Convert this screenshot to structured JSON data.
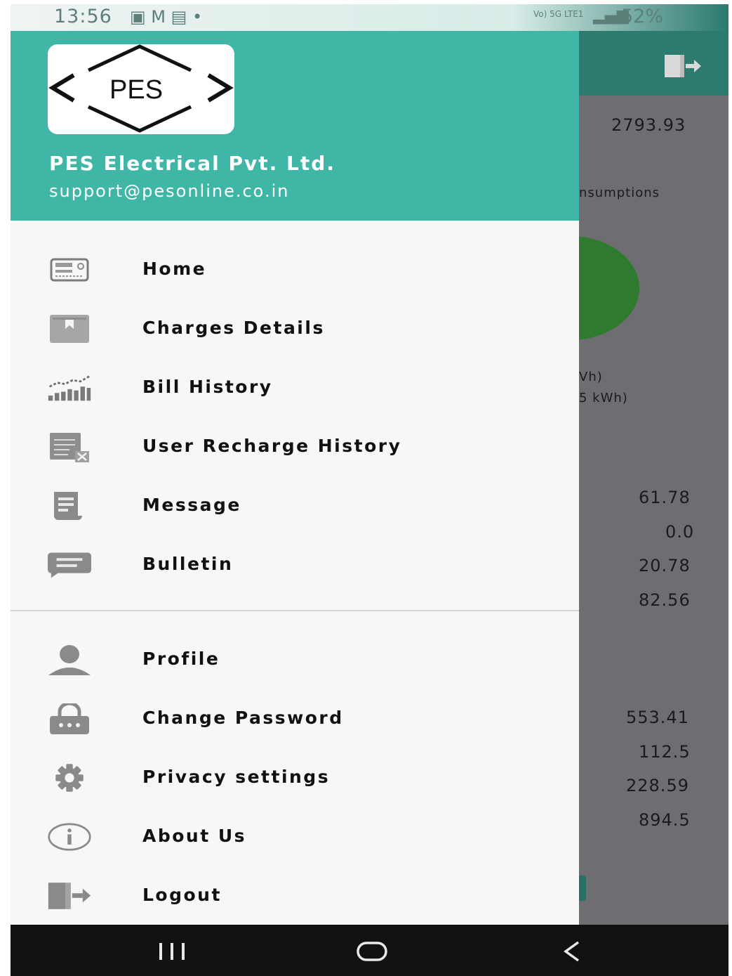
{
  "status_bar": {
    "time": "13:56",
    "notification_icons": "▣ M ▤ •",
    "network": "Vo) 5G LTE1",
    "signal": "▂▄▆",
    "battery": "52%"
  },
  "background_app": {
    "top_value": "2793.93",
    "consumptions_label": "nsumptions",
    "legend_line_1": "Vh)",
    "legend_line_2": "5 kWh)",
    "values_group_1": [
      "61.78",
      "0.0",
      "20.78",
      "82.56"
    ],
    "values_group_2": [
      "553.41",
      "112.5",
      "228.59",
      "894.5"
    ],
    "pie_color": "#2f7a2e"
  },
  "drawer": {
    "logo_text": "PES",
    "company_name": "PES Electrical Pvt. Ltd.",
    "email": "support@pesonline.co.in",
    "header_color": "#40b6a6",
    "menu_primary": [
      {
        "label": "Home",
        "icon": "meter-icon"
      },
      {
        "label": "Charges Details",
        "icon": "bookmark-book-icon"
      },
      {
        "label": "Bill History",
        "icon": "chart-history-icon"
      },
      {
        "label": "User Recharge History",
        "icon": "list-cancel-icon"
      },
      {
        "label": "Message",
        "icon": "receipt-icon"
      },
      {
        "label": "Bulletin",
        "icon": "chat-bubble-icon"
      }
    ],
    "menu_secondary": [
      {
        "label": "Profile",
        "icon": "person-icon"
      },
      {
        "label": "Change Password",
        "icon": "lock-icon"
      },
      {
        "label": "Privacy settings",
        "icon": "gear-icon"
      },
      {
        "label": "About Us",
        "icon": "info-icon"
      },
      {
        "label": "Logout",
        "icon": "logout-icon"
      }
    ]
  },
  "nav_bar": {
    "recents": "recents-icon",
    "home": "home-circle-icon",
    "back": "back-icon"
  }
}
